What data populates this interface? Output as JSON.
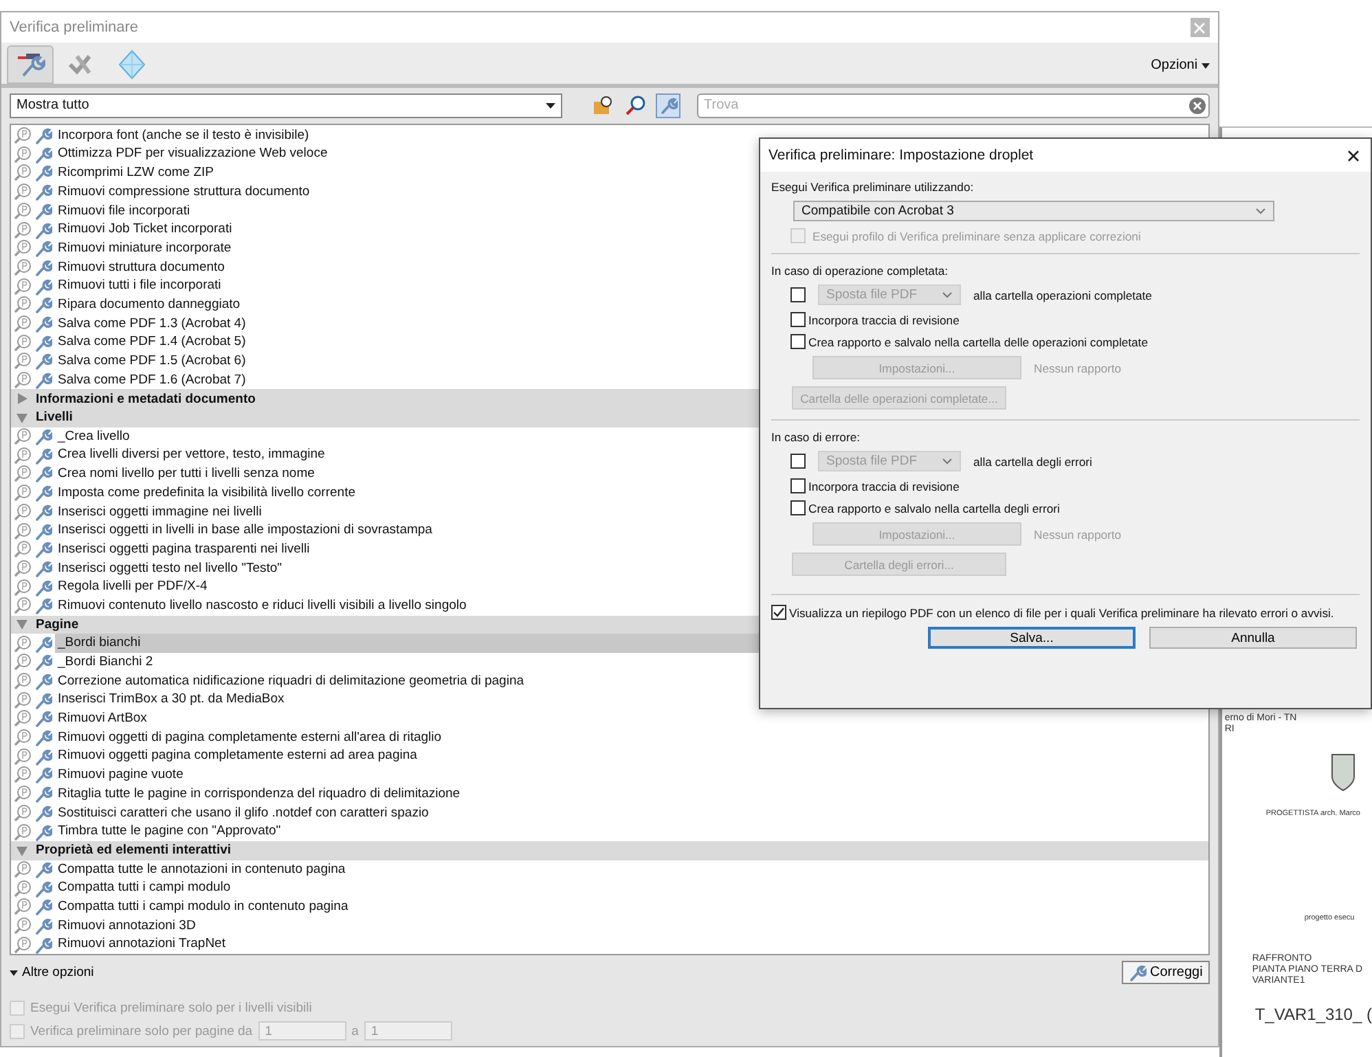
{
  "window": {
    "title": "Verifica preliminare"
  },
  "tabs": [
    {
      "selected": true
    },
    {
      "selected": false
    },
    {
      "selected": false
    }
  ],
  "options_menu": {
    "label": "Opzioni"
  },
  "filter": {
    "value": "Mostra tutto"
  },
  "view_buttons": [
    {
      "selected": false
    },
    {
      "selected": false
    },
    {
      "selected": true
    }
  ],
  "search": {
    "placeholder": "Trova"
  },
  "profile_list": {
    "items": [
      {
        "label": "Incorpora font (anche se il testo è invisibile)",
        "selected": false
      },
      {
        "label": "Ottimizza PDF per visualizzazione Web veloce",
        "selected": false
      },
      {
        "label": "Ricomprimi LZW come ZIP",
        "selected": false
      },
      {
        "label": "Rimuovi compressione struttura documento",
        "selected": false
      },
      {
        "label": "Rimuovi file incorporati",
        "selected": false
      },
      {
        "label": "Rimuovi Job Ticket incorporati",
        "selected": false
      },
      {
        "label": "Rimuovi miniature incorporate",
        "selected": false
      },
      {
        "label": "Rimuovi struttura documento",
        "selected": false
      },
      {
        "label": "Rimuovi tutti i file incorporati",
        "selected": false
      },
      {
        "label": "Ripara documento danneggiato",
        "selected": false
      },
      {
        "label": "Salva come PDF 1.3 (Acrobat 4)",
        "selected": false
      },
      {
        "label": "Salva come PDF 1.4 (Acrobat 5)",
        "selected": false
      },
      {
        "label": "Salva come PDF 1.5 (Acrobat 6)",
        "selected": false
      },
      {
        "label": "Salva come PDF 1.6 (Acrobat 7)",
        "selected": false
      }
    ],
    "groups": [
      {
        "label": "Informazioni e metadati documento",
        "expanded": false
      },
      {
        "label": "Livelli",
        "expanded": true,
        "children": [
          {
            "label": "_Crea livello",
            "selected": false
          },
          {
            "label": "Crea livelli diversi per vettore, testo, immagine",
            "selected": false
          },
          {
            "label": "Crea nomi livello per tutti i livelli senza nome",
            "selected": false
          },
          {
            "label": "Imposta come predefinita la visibilità livello corrente",
            "selected": false
          },
          {
            "label": "Inserisci oggetti immagine nei livelli",
            "selected": false
          },
          {
            "label": "Inserisci oggetti in livelli in base alle impostazioni di sovrastampa",
            "selected": false
          },
          {
            "label": "Inserisci oggetti pagina trasparenti nei livelli",
            "selected": false
          },
          {
            "label": "Inserisci oggetti testo nel livello \"Testo\"",
            "selected": false
          },
          {
            "label": "Regola livelli per PDF/X-4",
            "selected": false
          },
          {
            "label": "Rimuovi contenuto livello nascosto e riduci livelli visibili a livello singolo",
            "selected": false
          }
        ]
      },
      {
        "label": "Pagine",
        "expanded": true,
        "children": [
          {
            "label": "_Bordi bianchi",
            "selected": true
          },
          {
            "label": "_Bordi Bianchi 2",
            "selected": false
          },
          {
            "label": "Correzione automatica nidificazione riquadri di delimitazione geometria di pagina",
            "selected": false
          },
          {
            "label": "Inserisci TrimBox a 30 pt. da MediaBox",
            "selected": false
          },
          {
            "label": "Rimuovi ArtBox",
            "selected": false
          },
          {
            "label": "Rimuovi oggetti di pagina completamente esterni all'area di ritaglio",
            "selected": false
          },
          {
            "label": "Rimuovi oggetti pagina completamente esterni ad area pagina",
            "selected": false
          },
          {
            "label": "Rimuovi pagine vuote",
            "selected": false
          },
          {
            "label": "Ritaglia tutte le pagine in corrispondenza del riquadro di delimitazione",
            "selected": false
          },
          {
            "label": "Sostituisci caratteri che usano il glifo .notdef con caratteri spazio",
            "selected": false
          },
          {
            "label": "Timbra tutte le pagine con \"Approvato\"",
            "selected": false
          }
        ]
      },
      {
        "label": "Proprietà ed elementi interattivi",
        "expanded": true,
        "children": [
          {
            "label": "Compatta tutte le annotazioni in contenuto pagina",
            "selected": false
          },
          {
            "label": "Compatta tutti i campi modulo",
            "selected": false
          },
          {
            "label": "Compatta tutti i campi modulo in contenuto pagina",
            "selected": false
          },
          {
            "label": "Rimuovi annotazioni 3D",
            "selected": false
          },
          {
            "label": "Rimuovi annotazioni TrapNet",
            "selected": false
          }
        ]
      }
    ]
  },
  "more_options": {
    "label": "Altre opzioni",
    "expanded": true,
    "visible_layers": {
      "label": "Esegui Verifica preliminare solo per i livelli visibili",
      "checked": false,
      "disabled": true
    },
    "page_range": {
      "label": "Verifica preliminare solo per pagine da",
      "checked": false,
      "disabled": true,
      "from": "1",
      "separator": "a",
      "to": "1"
    }
  },
  "fix_button": {
    "label": "Correggi"
  },
  "document": {
    "lines": [
      "erno di Mori - TN",
      "RI"
    ],
    "designer": "PROGETTISTA   arch. Marco",
    "project": "progetto   esecu",
    "title_lines": [
      "RAFFRONTO",
      "PIANTA PIANO TERRA D",
      "VARIANTE1"
    ],
    "code": "T_VAR1_310_ ("
  },
  "dialog": {
    "title": "Verifica preliminare: Impostazione droplet",
    "profile_label": "Esegui Verifica preliminare utilizzando:",
    "profile_select": "Compatibile con Acrobat 3",
    "no_fix": {
      "label": "Esegui profilo di Verifica preliminare senza applicare correzioni",
      "checked": false,
      "disabled": true
    },
    "sections": [
      {
        "title": "In caso di operazione completata:",
        "move": {
          "checked": false,
          "select": "Sposta file PDF",
          "suffix": "alla cartella operazioni completate"
        },
        "options": [
          {
            "label": "Incorpora traccia di revisione",
            "checked": false
          },
          {
            "label": "Crea rapporto e salvalo nella cartella delle operazioni completate",
            "checked": false
          }
        ],
        "settings_button": "Impostazioni...",
        "report_status": "Nessun rapporto",
        "folder_button": "Cartella delle operazioni completate..."
      },
      {
        "title": "In caso di errore:",
        "move": {
          "checked": false,
          "select": "Sposta file PDF",
          "suffix": "alla cartella degli errori"
        },
        "options": [
          {
            "label": "Incorpora traccia di revisione",
            "checked": false
          },
          {
            "label": "Crea rapporto e salvalo nella cartella degli errori",
            "checked": false
          }
        ],
        "settings_button": "Impostazioni...",
        "report_status": "Nessun rapporto",
        "folder_button": "Cartella degli errori..."
      }
    ],
    "summary": {
      "label": "Visualizza un riepilogo PDF con un elenco di file per i quali Verifica preliminare ha rilevato errori o avvisi.",
      "checked": true
    },
    "buttons": [
      {
        "label": "Salva...",
        "focused": true
      },
      {
        "label": "Annulla",
        "focused": false
      }
    ]
  }
}
